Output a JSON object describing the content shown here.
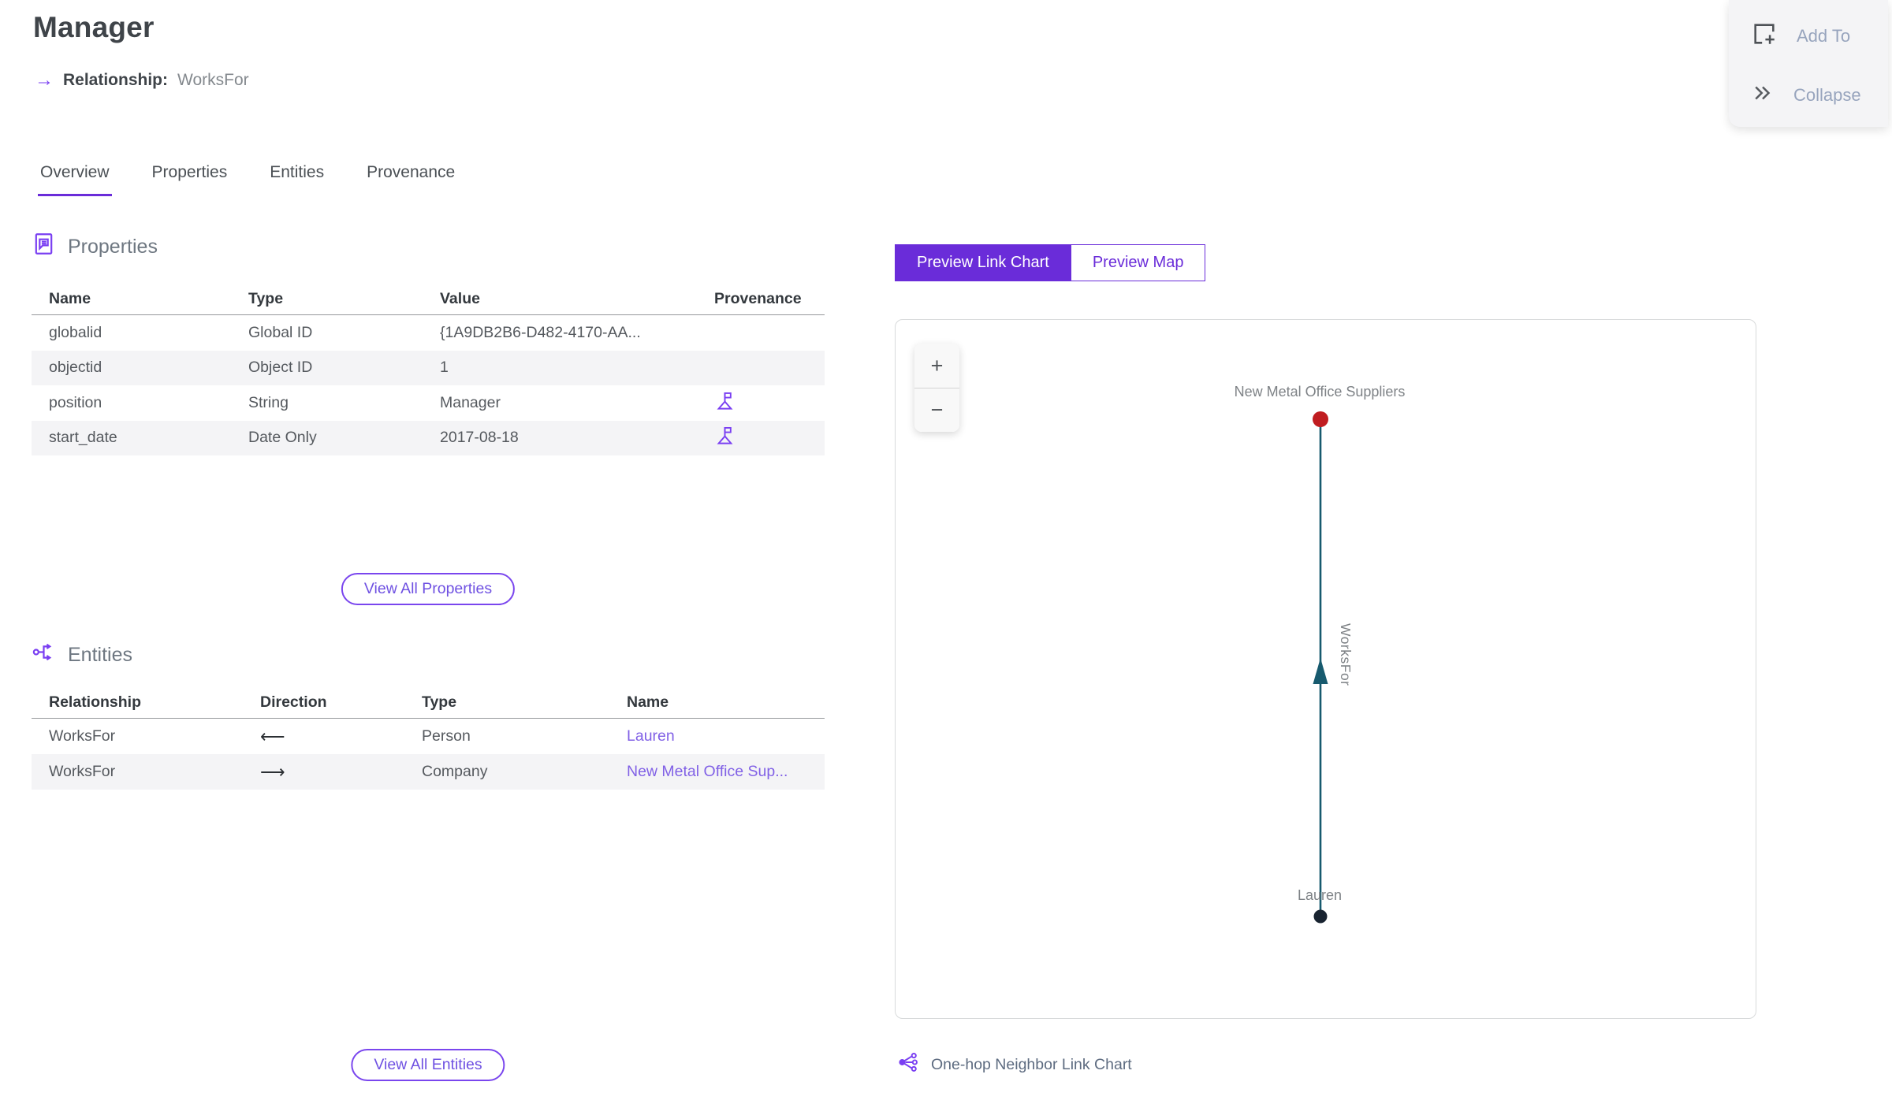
{
  "header": {
    "title": "Manager",
    "relationship_label": "Relationship:",
    "relationship_value": "WorksFor",
    "arrow_glyph": "→"
  },
  "actions": {
    "add_to_label": "Add To",
    "collapse_label": "Collapse"
  },
  "tabs": [
    {
      "label": "Overview"
    },
    {
      "label": "Properties"
    },
    {
      "label": "Entities"
    },
    {
      "label": "Provenance"
    }
  ],
  "properties_section": {
    "title": "Properties",
    "columns": [
      "Name",
      "Type",
      "Value",
      "Provenance"
    ],
    "rows": [
      {
        "name": "globalid",
        "type": "Global ID",
        "value": "{1A9DB2B6-D482-4170-AA..."
      },
      {
        "name": "objectid",
        "type": "Object ID",
        "value": "1"
      },
      {
        "name": "position",
        "type": "String",
        "value": "Manager"
      },
      {
        "name": "start_date",
        "type": "Date Only",
        "value": "2017-08-18"
      }
    ],
    "view_all_label": "View All Properties"
  },
  "entities_section": {
    "title": "Entities",
    "columns": [
      "Relationship",
      "Direction",
      "Type",
      "Name"
    ],
    "rows": [
      {
        "relationship": "WorksFor",
        "direction": "⟵",
        "type": "Person",
        "name": "Lauren"
      },
      {
        "relationship": "WorksFor",
        "direction": "⟶",
        "type": "Company",
        "name": "New Metal Office Sup..."
      }
    ],
    "view_all_label": "View All Entities"
  },
  "preview": {
    "link_chart_tab": "Preview Link Chart",
    "map_tab": "Preview Map",
    "zoom_in_glyph": "+",
    "zoom_out_glyph": "−",
    "caption": "One-hop Neighbor Link Chart",
    "graph": {
      "top_node_label": "New Metal Office Suppliers",
      "bottom_node_label": "Lauren",
      "edge_label": "WorksFor"
    }
  },
  "theme": {
    "accent": "#6a2cd9",
    "icon-purple": "#7a3ff2",
    "link-purple": "#8161e6",
    "edge-teal": "#175a6e",
    "node-red": "#c01c20",
    "node-dark": "#182330"
  }
}
